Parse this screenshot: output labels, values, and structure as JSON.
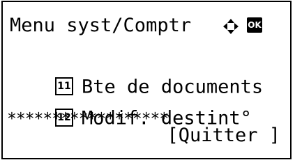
{
  "menu": {
    "title": "Menu syst/Comptr",
    "ok_label": "OK",
    "items": [
      {
        "number": "11",
        "label": "Bte de documents"
      },
      {
        "number": "12",
        "label": "Modif. destint°"
      }
    ],
    "separator": "******************",
    "softkey_right": "[Quitter ]"
  },
  "icons": {
    "navigation": "four-way-arrow-icon",
    "ok": "ok-key-icon"
  }
}
